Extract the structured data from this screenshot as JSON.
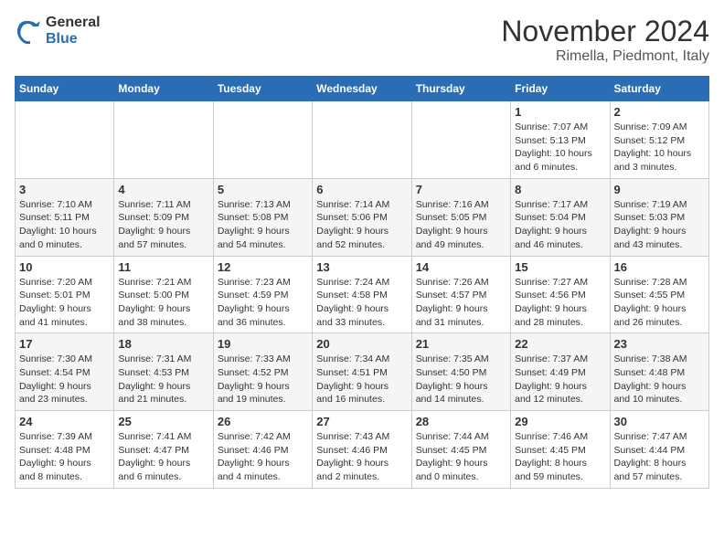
{
  "header": {
    "logo_general": "General",
    "logo_blue": "Blue",
    "month_title": "November 2024",
    "location": "Rimella, Piedmont, Italy"
  },
  "weekdays": [
    "Sunday",
    "Monday",
    "Tuesday",
    "Wednesday",
    "Thursday",
    "Friday",
    "Saturday"
  ],
  "weeks": [
    {
      "cells": [
        {
          "empty": true
        },
        {
          "empty": true
        },
        {
          "empty": true
        },
        {
          "empty": true
        },
        {
          "empty": true
        },
        {
          "day": "1",
          "lines": [
            "Sunrise: 7:07 AM",
            "Sunset: 5:13 PM",
            "Daylight: 10 hours",
            "and 6 minutes."
          ]
        },
        {
          "day": "2",
          "lines": [
            "Sunrise: 7:09 AM",
            "Sunset: 5:12 PM",
            "Daylight: 10 hours",
            "and 3 minutes."
          ]
        }
      ]
    },
    {
      "cells": [
        {
          "day": "3",
          "lines": [
            "Sunrise: 7:10 AM",
            "Sunset: 5:11 PM",
            "Daylight: 10 hours",
            "and 0 minutes."
          ]
        },
        {
          "day": "4",
          "lines": [
            "Sunrise: 7:11 AM",
            "Sunset: 5:09 PM",
            "Daylight: 9 hours",
            "and 57 minutes."
          ]
        },
        {
          "day": "5",
          "lines": [
            "Sunrise: 7:13 AM",
            "Sunset: 5:08 PM",
            "Daylight: 9 hours",
            "and 54 minutes."
          ]
        },
        {
          "day": "6",
          "lines": [
            "Sunrise: 7:14 AM",
            "Sunset: 5:06 PM",
            "Daylight: 9 hours",
            "and 52 minutes."
          ]
        },
        {
          "day": "7",
          "lines": [
            "Sunrise: 7:16 AM",
            "Sunset: 5:05 PM",
            "Daylight: 9 hours",
            "and 49 minutes."
          ]
        },
        {
          "day": "8",
          "lines": [
            "Sunrise: 7:17 AM",
            "Sunset: 5:04 PM",
            "Daylight: 9 hours",
            "and 46 minutes."
          ]
        },
        {
          "day": "9",
          "lines": [
            "Sunrise: 7:19 AM",
            "Sunset: 5:03 PM",
            "Daylight: 9 hours",
            "and 43 minutes."
          ]
        }
      ]
    },
    {
      "cells": [
        {
          "day": "10",
          "lines": [
            "Sunrise: 7:20 AM",
            "Sunset: 5:01 PM",
            "Daylight: 9 hours",
            "and 41 minutes."
          ]
        },
        {
          "day": "11",
          "lines": [
            "Sunrise: 7:21 AM",
            "Sunset: 5:00 PM",
            "Daylight: 9 hours",
            "and 38 minutes."
          ]
        },
        {
          "day": "12",
          "lines": [
            "Sunrise: 7:23 AM",
            "Sunset: 4:59 PM",
            "Daylight: 9 hours",
            "and 36 minutes."
          ]
        },
        {
          "day": "13",
          "lines": [
            "Sunrise: 7:24 AM",
            "Sunset: 4:58 PM",
            "Daylight: 9 hours",
            "and 33 minutes."
          ]
        },
        {
          "day": "14",
          "lines": [
            "Sunrise: 7:26 AM",
            "Sunset: 4:57 PM",
            "Daylight: 9 hours",
            "and 31 minutes."
          ]
        },
        {
          "day": "15",
          "lines": [
            "Sunrise: 7:27 AM",
            "Sunset: 4:56 PM",
            "Daylight: 9 hours",
            "and 28 minutes."
          ]
        },
        {
          "day": "16",
          "lines": [
            "Sunrise: 7:28 AM",
            "Sunset: 4:55 PM",
            "Daylight: 9 hours",
            "and 26 minutes."
          ]
        }
      ]
    },
    {
      "cells": [
        {
          "day": "17",
          "lines": [
            "Sunrise: 7:30 AM",
            "Sunset: 4:54 PM",
            "Daylight: 9 hours",
            "and 23 minutes."
          ]
        },
        {
          "day": "18",
          "lines": [
            "Sunrise: 7:31 AM",
            "Sunset: 4:53 PM",
            "Daylight: 9 hours",
            "and 21 minutes."
          ]
        },
        {
          "day": "19",
          "lines": [
            "Sunrise: 7:33 AM",
            "Sunset: 4:52 PM",
            "Daylight: 9 hours",
            "and 19 minutes."
          ]
        },
        {
          "day": "20",
          "lines": [
            "Sunrise: 7:34 AM",
            "Sunset: 4:51 PM",
            "Daylight: 9 hours",
            "and 16 minutes."
          ]
        },
        {
          "day": "21",
          "lines": [
            "Sunrise: 7:35 AM",
            "Sunset: 4:50 PM",
            "Daylight: 9 hours",
            "and 14 minutes."
          ]
        },
        {
          "day": "22",
          "lines": [
            "Sunrise: 7:37 AM",
            "Sunset: 4:49 PM",
            "Daylight: 9 hours",
            "and 12 minutes."
          ]
        },
        {
          "day": "23",
          "lines": [
            "Sunrise: 7:38 AM",
            "Sunset: 4:48 PM",
            "Daylight: 9 hours",
            "and 10 minutes."
          ]
        }
      ]
    },
    {
      "cells": [
        {
          "day": "24",
          "lines": [
            "Sunrise: 7:39 AM",
            "Sunset: 4:48 PM",
            "Daylight: 9 hours",
            "and 8 minutes."
          ]
        },
        {
          "day": "25",
          "lines": [
            "Sunrise: 7:41 AM",
            "Sunset: 4:47 PM",
            "Daylight: 9 hours",
            "and 6 minutes."
          ]
        },
        {
          "day": "26",
          "lines": [
            "Sunrise: 7:42 AM",
            "Sunset: 4:46 PM",
            "Daylight: 9 hours",
            "and 4 minutes."
          ]
        },
        {
          "day": "27",
          "lines": [
            "Sunrise: 7:43 AM",
            "Sunset: 4:46 PM",
            "Daylight: 9 hours",
            "and 2 minutes."
          ]
        },
        {
          "day": "28",
          "lines": [
            "Sunrise: 7:44 AM",
            "Sunset: 4:45 PM",
            "Daylight: 9 hours",
            "and 0 minutes."
          ]
        },
        {
          "day": "29",
          "lines": [
            "Sunrise: 7:46 AM",
            "Sunset: 4:45 PM",
            "Daylight: 8 hours",
            "and 59 minutes."
          ]
        },
        {
          "day": "30",
          "lines": [
            "Sunrise: 7:47 AM",
            "Sunset: 4:44 PM",
            "Daylight: 8 hours",
            "and 57 minutes."
          ]
        }
      ]
    }
  ]
}
